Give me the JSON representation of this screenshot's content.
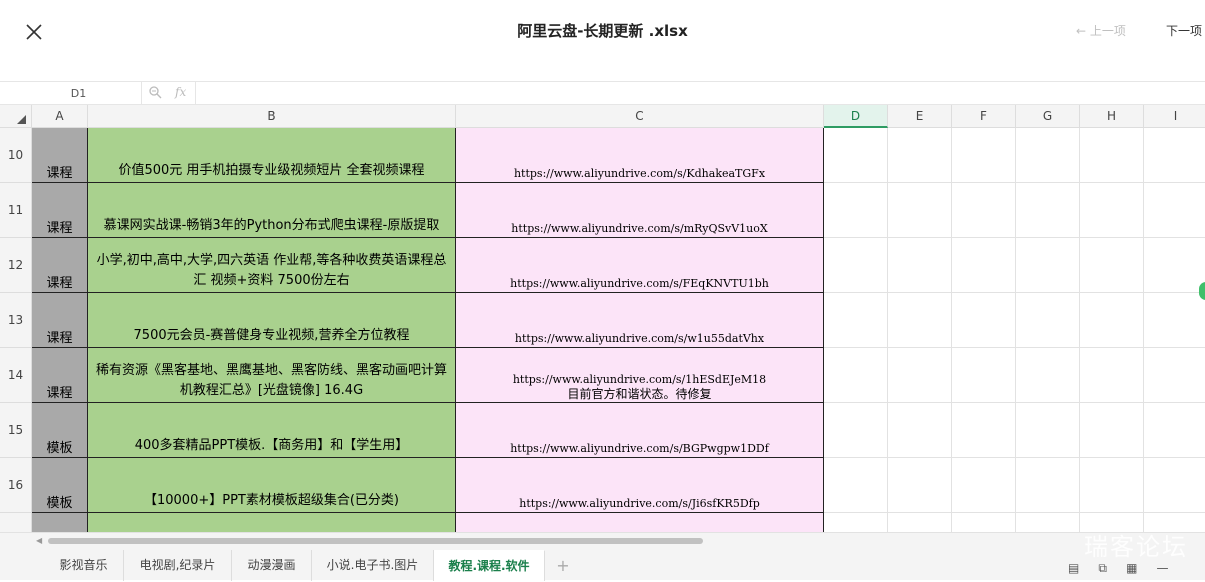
{
  "header": {
    "title": "阿里云盘-长期更新 .xlsx",
    "prev_label": "← 上一项",
    "next_label": "下一项"
  },
  "formula_bar": {
    "cell_ref": "D1",
    "zoom_icon": "magnifier-icon",
    "fx_label": "fx",
    "value": ""
  },
  "columns": [
    "A",
    "B",
    "C",
    "D",
    "E",
    "F",
    "G",
    "H",
    "I"
  ],
  "active_column": "D",
  "rows": [
    {
      "num": "10",
      "a": "课程",
      "b": "价值500元 用手机拍摄专业级视频短片 全套视频课程",
      "c": "https://www.aliyundrive.com/s/KdhakeaTGFx",
      "c_note": ""
    },
    {
      "num": "11",
      "a": "课程",
      "b": "慕课网实战课-畅销3年的Python分布式爬虫课程-原版提取",
      "c": "https://www.aliyundrive.com/s/mRyQSvV1uoX",
      "c_note": ""
    },
    {
      "num": "12",
      "a": "课程",
      "b": "小学,初中,高中,大学,四六英语 作业帮,等各种收费英语课程总汇 视频+资料 7500份左右",
      "c": "https://www.aliyundrive.com/s/FEqKNVTU1bh",
      "c_note": ""
    },
    {
      "num": "13",
      "a": "课程",
      "b": "7500元会员-赛普健身专业视频,营养全方位教程",
      "c": "https://www.aliyundrive.com/s/w1u55datVhx",
      "c_note": ""
    },
    {
      "num": "14",
      "a": "课程",
      "b": "稀有资源《黑客基地、黑鹰基地、黑客防线、黑客动画吧计算机教程汇总》[光盘镜像] 16.4G",
      "c": "https://www.aliyundrive.com/s/1hESdEJeM18",
      "c_note": "目前官方和谐状态。待修复"
    },
    {
      "num": "15",
      "a": "模板",
      "b": "400多套精品PPT模板.【商务用】和【学生用】",
      "c": "https://www.aliyundrive.com/s/BGPwgpw1DDf",
      "c_note": ""
    },
    {
      "num": "16",
      "a": "模板",
      "b": "【10000+】PPT素材模板超级集合(已分类)",
      "c": "https://www.aliyundrive.com/s/Ji6sfKR5Dfp",
      "c_note": ""
    },
    {
      "num": "",
      "a": "",
      "b": "",
      "c": "",
      "c_note": ""
    }
  ],
  "tabs": [
    {
      "label": "影视音乐",
      "active": false
    },
    {
      "label": "电视剧,纪录片",
      "active": false
    },
    {
      "label": "动漫漫画",
      "active": false
    },
    {
      "label": "小说.电子书.图片",
      "active": false
    },
    {
      "label": "教程.课程.软件",
      "active": true
    }
  ],
  "tab_add_label": "+",
  "watermark": "瑞客论坛",
  "colors": {
    "col_a_fill": "#a9a9a9",
    "col_b_fill": "#a9d18e",
    "col_c_fill": "#fce4f8",
    "accent": "#1a7f4b"
  }
}
